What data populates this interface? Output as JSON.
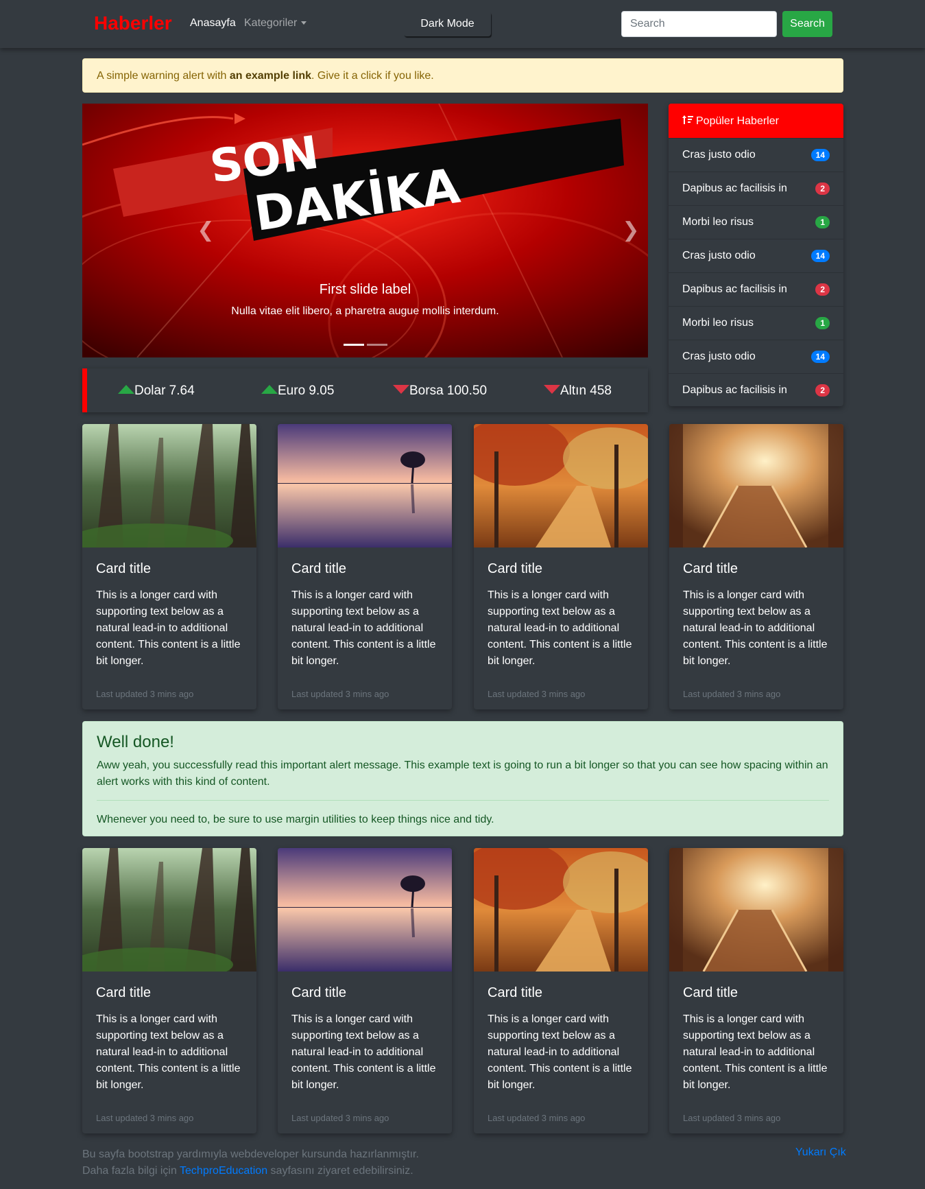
{
  "navbar": {
    "brand": "Haberler",
    "home": "Anasayfa",
    "categories": "Kategoriler",
    "dark_mode": "Dark Mode",
    "search_placeholder": "Search",
    "search_button": "Search"
  },
  "warning_alert": {
    "before": "A simple warning alert with ",
    "link": "an example link",
    "after": ". Give it a click if you like."
  },
  "carousel": {
    "banner_line1": "SON",
    "banner_line2": "DAKİKA",
    "caption_title": "First slide label",
    "caption_text": "Nulla vitae elit libero, a pharetra augue mollis interdum.",
    "slide_count": 2,
    "active_slide": 1
  },
  "ticker": [
    {
      "label": "Dolar 7.64",
      "direction": "up"
    },
    {
      "label": "Euro 9.05",
      "direction": "up"
    },
    {
      "label": "Borsa 100.50",
      "direction": "down"
    },
    {
      "label": "Altın 458",
      "direction": "down"
    }
  ],
  "popular": {
    "header": "Popüler Haberler",
    "icon": "sort-icon",
    "items": [
      {
        "label": "Cras justo odio",
        "count": "14",
        "color": "#007bff"
      },
      {
        "label": "Dapibus ac facilisis in",
        "count": "2",
        "color": "#dc3545"
      },
      {
        "label": "Morbi leo risus",
        "count": "1",
        "color": "#28a745"
      },
      {
        "label": "Cras justo odio",
        "count": "14",
        "color": "#007bff"
      },
      {
        "label": "Dapibus ac facilisis in",
        "count": "2",
        "color": "#dc3545"
      },
      {
        "label": "Morbi leo risus",
        "count": "1",
        "color": "#28a745"
      },
      {
        "label": "Cras justo odio",
        "count": "14",
        "color": "#007bff"
      },
      {
        "label": "Dapibus ac facilisis in",
        "count": "2",
        "color": "#dc3545"
      }
    ]
  },
  "cards": {
    "title": "Card title",
    "text": "This is a longer card with supporting text below as a natural lead-in to additional content. This content is a little bit longer.",
    "footer": "Last updated 3 mins ago"
  },
  "success_alert": {
    "heading": "Well done!",
    "text": "Aww yeah, you successfully read this important alert message. This example text is going to run a bit longer so that you can see how spacing within an alert works with this kind of content.",
    "note": "Whenever you need to, be sure to use margin utilities to keep things nice and tidy."
  },
  "footer": {
    "line1": "Bu sayfa bootstrap yardımıyla webdeveloper kursunda hazırlanmıştır.",
    "line2_before": "Daha fazla bilgi için ",
    "line2_link": "TechproEducation",
    "line2_after": " sayfasını ziyaret edebilirsiniz.",
    "to_top": "Yukarı Çık"
  },
  "colors": {
    "background": "#343a40",
    "brand": "#ff0000",
    "success": "#28a745",
    "danger": "#dc3545",
    "primary": "#007bff"
  }
}
